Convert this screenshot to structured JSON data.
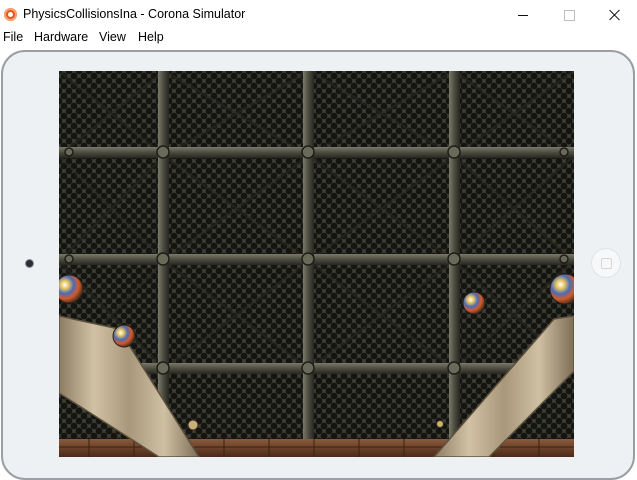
{
  "window": {
    "title": "PhysicsCollisionsIna - Corona Simulator",
    "icon": "corona-app-icon",
    "controls": [
      "minimize-icon",
      "maximize-icon",
      "close-icon"
    ]
  },
  "menu": {
    "file": "File",
    "hardware": "Hardware",
    "view": "View",
    "help": "Help"
  },
  "device": {
    "type": "tablet-landscape",
    "frame_color": "#eef1f3"
  },
  "game": {
    "background": "metal-grate",
    "marbles": 5,
    "chips": 2,
    "ramps": 2,
    "colors": {
      "grate": "#3a3b35",
      "mesh": "#151511",
      "frame": "#5a5a4e",
      "ramp": "#b7a58a",
      "floor": "#6b3e26"
    }
  }
}
